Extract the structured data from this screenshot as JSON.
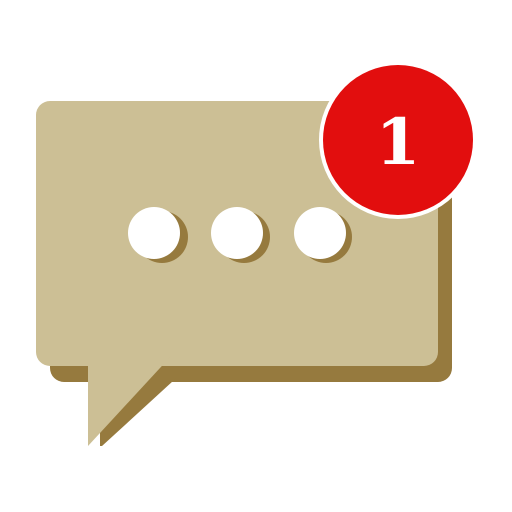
{
  "icon": {
    "name": "chat-bubble-notification-icon",
    "bubble_color": "#CCBF95",
    "bubble_shadow_color": "#967A3E",
    "dot_color": "#FFFFFF",
    "dot_count": 3
  },
  "badge": {
    "count": "1",
    "color": "#E20E0E",
    "border_color": "#FFFFFF",
    "text_color": "#FFFFFF"
  }
}
